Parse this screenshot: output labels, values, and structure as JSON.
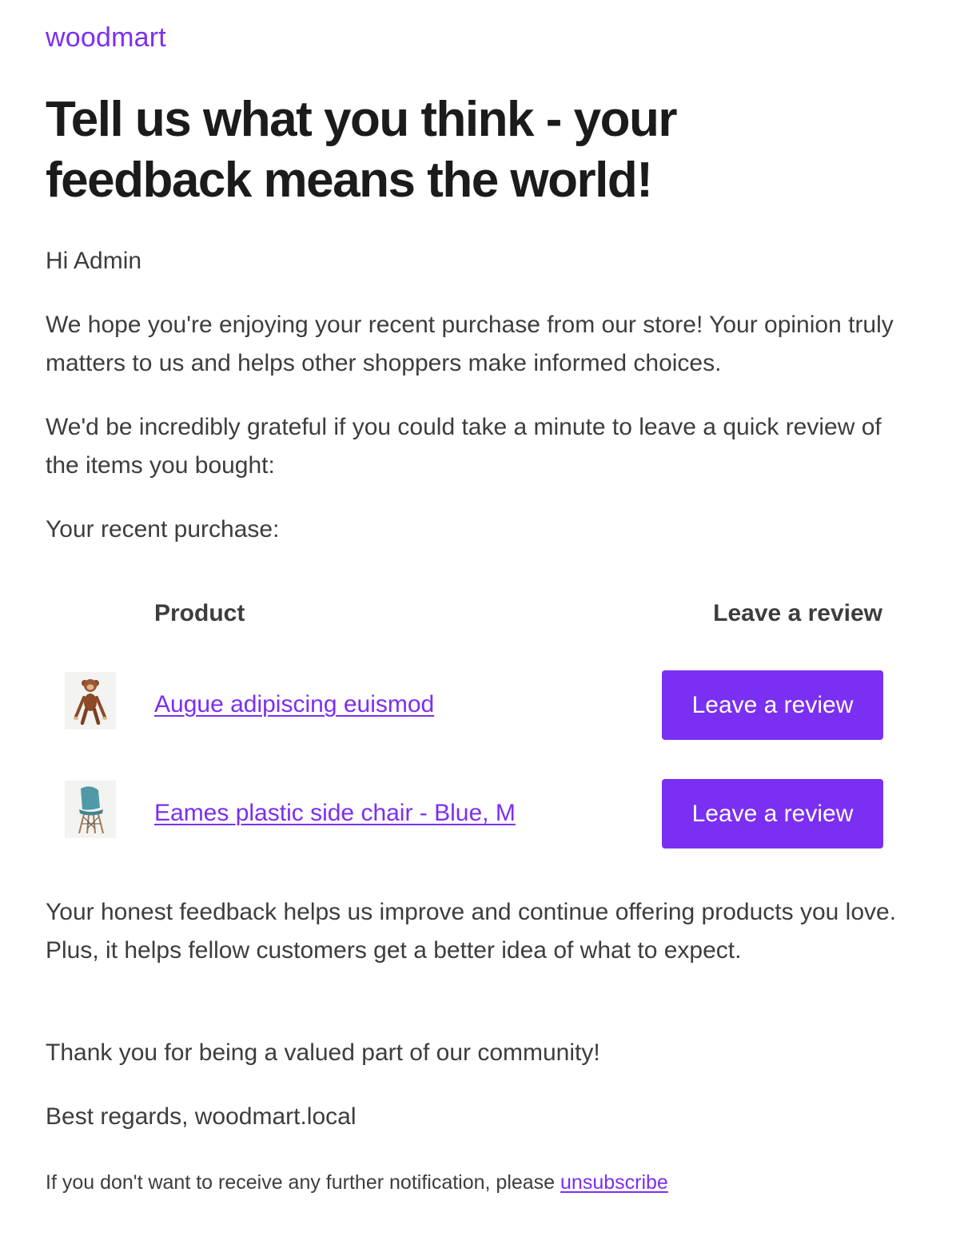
{
  "brand": {
    "logo_text": "woodmart",
    "accent_color": "#7b2ff2"
  },
  "headline": "Tell us what you think - your feedback means the world!",
  "greeting": "Hi Admin",
  "paragraphs": {
    "intro": "We hope you're enjoying your recent purchase from our store! Your opinion truly matters to us and helps other shoppers make informed choices.",
    "request": "We'd be incredibly grateful if you could take a minute to leave a quick review of the items you bought:",
    "recent_purchase": "Your recent purchase:",
    "honest_feedback": "Your honest feedback helps us improve and continue offering products you love. Plus, it helps fellow customers get a better idea of what to expect.",
    "thanks": "Thank you for being a valued part of our community!",
    "regards": "Best regards, woodmart.local"
  },
  "table": {
    "headers": {
      "product": "Product",
      "review": "Leave a review"
    },
    "rows": [
      {
        "product_name": "Augue adipiscing euismod",
        "thumbnail_icon": "wooden-monkey-toy-icon",
        "button_label": "Leave a review"
      },
      {
        "product_name": "Eames plastic side chair - Blue, M",
        "thumbnail_icon": "blue-side-chair-icon",
        "button_label": "Leave a review"
      }
    ]
  },
  "footer": {
    "note_text": "If you don't want to receive any further notification, please ",
    "unsubscribe_label": "unsubscribe"
  }
}
